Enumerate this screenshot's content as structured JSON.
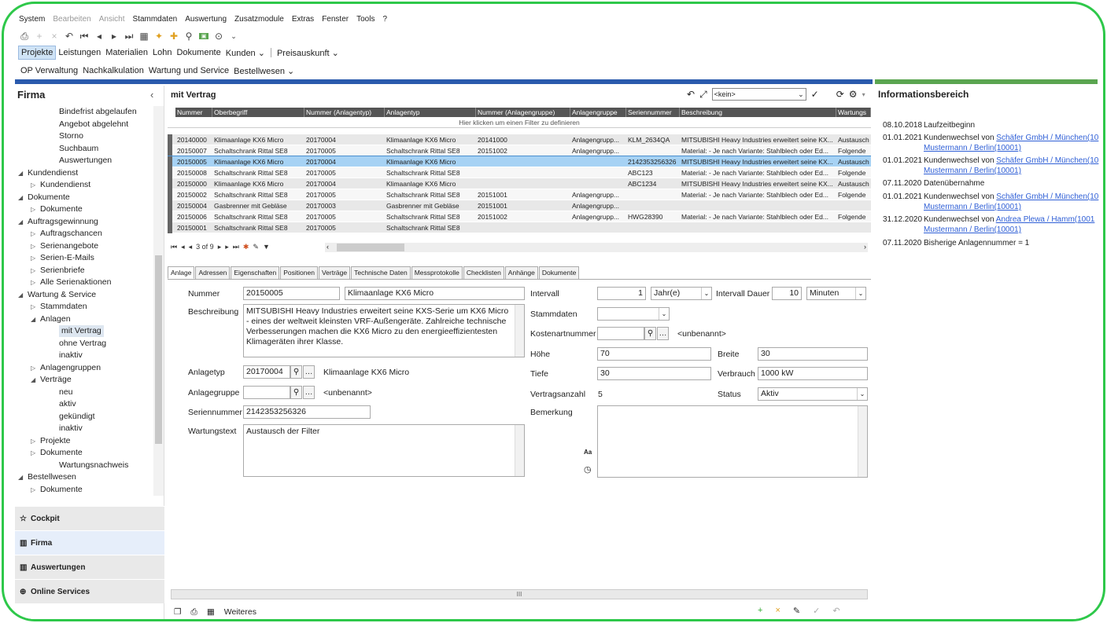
{
  "menu": [
    "System",
    "Bearbeiten",
    "Ansicht",
    "Stammdaten",
    "Auswertung",
    "Zusatzmodule",
    "Extras",
    "Fenster",
    "Tools",
    "?"
  ],
  "menu_disabled": [
    "Bearbeiten",
    "Ansicht"
  ],
  "ribbon1": [
    "Projekte",
    "Leistungen",
    "Materialien",
    "Lohn",
    "Dokumente",
    "Kunden ⌄",
    "Preisauskunft ⌄"
  ],
  "ribbon2": [
    "OP Verwaltung",
    "Nachkalkulation",
    "Wartung und Service",
    "Bestellwesen ⌄"
  ],
  "nav": {
    "title": "Firma",
    "tree": [
      {
        "label": "Bindefrist abgelaufen",
        "level": 3,
        "arrow": ""
      },
      {
        "label": "Angebot abgelehnt",
        "level": 3,
        "arrow": ""
      },
      {
        "label": "Storno",
        "level": 3,
        "arrow": ""
      },
      {
        "label": "Suchbaum",
        "level": 3,
        "arrow": ""
      },
      {
        "label": "Auswertungen",
        "level": 3,
        "arrow": ""
      },
      {
        "label": "Kundendienst",
        "level": 1,
        "arrow": "◢"
      },
      {
        "label": "Kundendienst",
        "level": 2,
        "arrow": "▷"
      },
      {
        "label": "Dokumente",
        "level": 1,
        "arrow": "◢"
      },
      {
        "label": "Dokumente",
        "level": 2,
        "arrow": "▷"
      },
      {
        "label": "Auftragsgewinnung",
        "level": 1,
        "arrow": "◢"
      },
      {
        "label": "Auftragschancen",
        "level": 2,
        "arrow": "▷"
      },
      {
        "label": "Serienangebote",
        "level": 2,
        "arrow": "▷"
      },
      {
        "label": "Serien-E-Mails",
        "level": 2,
        "arrow": "▷"
      },
      {
        "label": "Serienbriefe",
        "level": 2,
        "arrow": "▷"
      },
      {
        "label": "Alle Serienaktionen",
        "level": 2,
        "arrow": "▷"
      },
      {
        "label": "Wartung & Service",
        "level": 1,
        "arrow": "◢"
      },
      {
        "label": "Stammdaten",
        "level": 2,
        "arrow": "▷"
      },
      {
        "label": "Anlagen",
        "level": 2,
        "arrow": "◢"
      },
      {
        "label": "mit Vertrag",
        "level": 3,
        "arrow": "",
        "selected": true
      },
      {
        "label": "ohne Vertrag",
        "level": 3,
        "arrow": ""
      },
      {
        "label": "inaktiv",
        "level": 3,
        "arrow": ""
      },
      {
        "label": "Anlagengruppen",
        "level": 2,
        "arrow": "▷"
      },
      {
        "label": "Verträge",
        "level": 2,
        "arrow": "◢"
      },
      {
        "label": "neu",
        "level": 3,
        "arrow": ""
      },
      {
        "label": "aktiv",
        "level": 3,
        "arrow": ""
      },
      {
        "label": "gekündigt",
        "level": 3,
        "arrow": ""
      },
      {
        "label": "inaktiv",
        "level": 3,
        "arrow": ""
      },
      {
        "label": "Projekte",
        "level": 2,
        "arrow": "▷"
      },
      {
        "label": "Dokumente",
        "level": 2,
        "arrow": "▷"
      },
      {
        "label": "Wartungsnachweis",
        "level": 3,
        "arrow": ""
      },
      {
        "label": "Bestellwesen",
        "level": 1,
        "arrow": "◢"
      },
      {
        "label": "Dokumente",
        "level": 2,
        "arrow": "▷"
      }
    ],
    "sections": [
      {
        "label": "Cockpit",
        "icon": "☆"
      },
      {
        "label": "Firma",
        "icon": "▥",
        "active": true
      },
      {
        "label": "Auswertungen",
        "icon": "▥"
      },
      {
        "label": "Online Services",
        "icon": "⊕"
      }
    ]
  },
  "center": {
    "title": "mit Vertrag",
    "filter_combo": "<kein>",
    "grid": {
      "columns": [
        "Nummer",
        "Oberbegriff",
        "Nummer (Anlagentyp)",
        "Anlagentyp",
        "Nummer (Anlagengruppe)",
        "Anlagengruppe",
        "Seriennummer",
        "Beschreibung",
        "Wartungs"
      ],
      "filter_hint": "Hier klicken um einen Filter zu definieren",
      "rows": [
        [
          "20140000",
          "Klimaanlage KX6 Micro",
          "20170004",
          "Klimaanlage KX6 Micro",
          "20141000",
          "Anlagengrupp...",
          "KLM_2634QA",
          "MITSUBISHI Heavy Industries erweitert seine KX...",
          "Austausch"
        ],
        [
          "20150007",
          "Schaltschrank Rittal SE8",
          "20170005",
          "Schaltschrank Rittal SE8",
          "20151002",
          "Anlagengrupp...",
          "",
          "Material: - Je nach Variante: Stahlblech oder Ed...",
          "Folgende"
        ],
        [
          "20150005",
          "Klimaanlage KX6 Micro",
          "20170004",
          "Klimaanlage KX6 Micro",
          "",
          "",
          "2142353256326",
          "MITSUBISHI Heavy Industries erweitert seine KX...",
          "Austausch"
        ],
        [
          "20150008",
          "Schaltschrank Rittal SE8",
          "20170005",
          "Schaltschrank Rittal SE8",
          "",
          "",
          "ABC123",
          "Material: - Je nach Variante: Stahlblech oder Ed...",
          "Folgende"
        ],
        [
          "20150000",
          "Klimaanlage KX6 Micro",
          "20170004",
          "Klimaanlage KX6 Micro",
          "",
          "",
          "ABC1234",
          "MITSUBISHI Heavy Industries erweitert seine KX...",
          "Austausch"
        ],
        [
          "20150002",
          "Schaltschrank Rittal SE8",
          "20170005",
          "Schaltschrank Rittal SE8",
          "20151001",
          "Anlagengrupp...",
          "",
          "Material: - Je nach Variante: Stahlblech oder Ed...",
          "Folgende"
        ],
        [
          "20150004",
          "Gasbrenner mit Gebläse",
          "20170003",
          "Gasbrenner mit Gebläse",
          "20151001",
          "Anlagengrupp...",
          "",
          "",
          ""
        ],
        [
          "20150006",
          "Schaltschrank Rittal SE8",
          "20170005",
          "Schaltschrank Rittal SE8",
          "20151002",
          "Anlagengrupp...",
          "HWG28390",
          "Material: - Je nach Variante: Stahlblech oder Ed...",
          "Folgende"
        ],
        [
          "20150001",
          "Schaltschrank Rittal SE8",
          "20170005",
          "Schaltschrank Rittal SE8",
          "",
          "",
          "",
          "",
          ""
        ]
      ],
      "selected_row": 2,
      "pager": "3 of 9"
    },
    "tabs": [
      "Anlage",
      "Adressen",
      "Eigenschaften",
      "Positionen",
      "Verträge",
      "Technische Daten",
      "Messprotokolle",
      "Checklisten",
      "Anhänge",
      "Dokumente"
    ],
    "form": {
      "nummer_label": "Nummer",
      "nummer": "20150005",
      "nummer_name": "Klimaanlage KX6 Micro",
      "beschreibung_label": "Beschreibung",
      "beschreibung": "MITSUBISHI Heavy Industries erweitert seine KXS-Serie um KX6 Micro - eines der weltweit kleinsten VRF-Außengeräte. Zahlreiche technische Verbesserungen machen die KX6 Micro zu den energieeffizientesten Klimageräten ihrer Klasse.",
      "anlagetyp_label": "Anlagetyp",
      "anlagetyp": "20170004",
      "anlagetyp_name": "Klimaanlage KX6 Micro",
      "anlagegruppe_label": "Anlagegruppe",
      "anlagegruppe": "",
      "anlagegruppe_name": "<unbenannt>",
      "seriennummer_label": "Seriennummer",
      "seriennummer": "2142353256326",
      "wartungstext_label": "Wartungstext",
      "wartungstext": "Austausch der Filter",
      "intervall_label": "Intervall",
      "intervall": "1",
      "intervall_unit": "Jahr(e)",
      "intervall_dauer_label": "Intervall Dauer",
      "intervall_dauer": "10",
      "intervall_dauer_unit": "Minuten",
      "stammdaten_label": "Stammdaten",
      "stammdaten": "",
      "kostenart_label": "Kostenartnummer",
      "kostenart": "",
      "kostenart_name": "<unbenannt>",
      "hoehe_label": "Höhe",
      "hoehe": "70",
      "breite_label": "Breite",
      "breite": "30",
      "tiefe_label": "Tiefe",
      "tiefe": "30",
      "verbrauch_label": "Verbrauch",
      "verbrauch": "1000 kW",
      "vertragsanzahl_label": "Vertragsanzahl",
      "vertragsanzahl": "5",
      "status_label": "Status",
      "status": "Aktiv",
      "bemerkung_label": "Bemerkung",
      "bemerkung": "",
      "aa": "Aa"
    },
    "bottom_weiteres": "Weiteres"
  },
  "info": {
    "title": "Informationsbereich",
    "entries": [
      {
        "date": "08.10.2018",
        "text": "Laufzeitbeginn",
        "link": "",
        "link2": ""
      },
      {
        "date": "01.01.2021",
        "text": "Kundenwechsel von ",
        "link": "Schäfer GmbH / München(10",
        "link2": "Mustermann / Berlin(10001)"
      },
      {
        "date": "01.01.2021",
        "text": "Kundenwechsel von ",
        "link": "Schäfer GmbH / München(10",
        "link2": "Mustermann / Berlin(10001)"
      },
      {
        "date": "07.11.2020",
        "text": "Datenübernahme",
        "link": "",
        "link2": ""
      },
      {
        "date": "01.01.2021",
        "text": "Kundenwechsel von ",
        "link": "Schäfer GmbH / München(10",
        "link2": "Mustermann / Berlin(10001)"
      },
      {
        "date": "31.12.2020",
        "text": "Kundenwechsel von ",
        "link": "Andrea Plewa / Hamm(1001",
        "link2": "Mustermann / Berlin(10001)"
      },
      {
        "date": "07.11.2020",
        "text": "Bisherige Anlagennummer = 1",
        "link": "",
        "link2": ""
      }
    ]
  }
}
